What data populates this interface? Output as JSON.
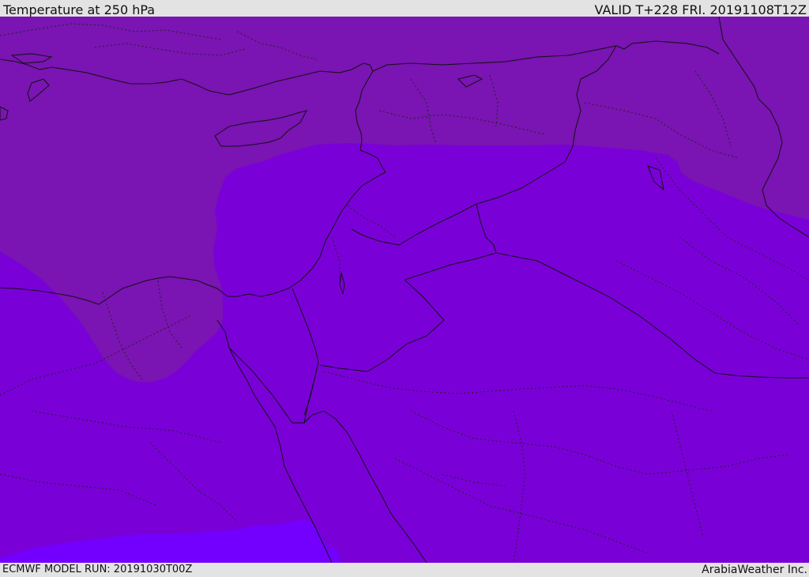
{
  "header": {
    "title": "Temperature at 250 hPa",
    "valid_time": "VALID T+228 FRI. 20191108T12Z"
  },
  "footer": {
    "model_run": "ECMWF MODEL RUN: 20191030T00Z",
    "credit": "ArabiaWeather Inc."
  },
  "map": {
    "field": "temperature",
    "level": "250 hPa",
    "colors": {
      "cold_zone": "#7a14b2",
      "mid_zone": "#7a00d8",
      "warm_zone": "#7300ff",
      "coastline": "#111111",
      "border": "#111111"
    }
  }
}
